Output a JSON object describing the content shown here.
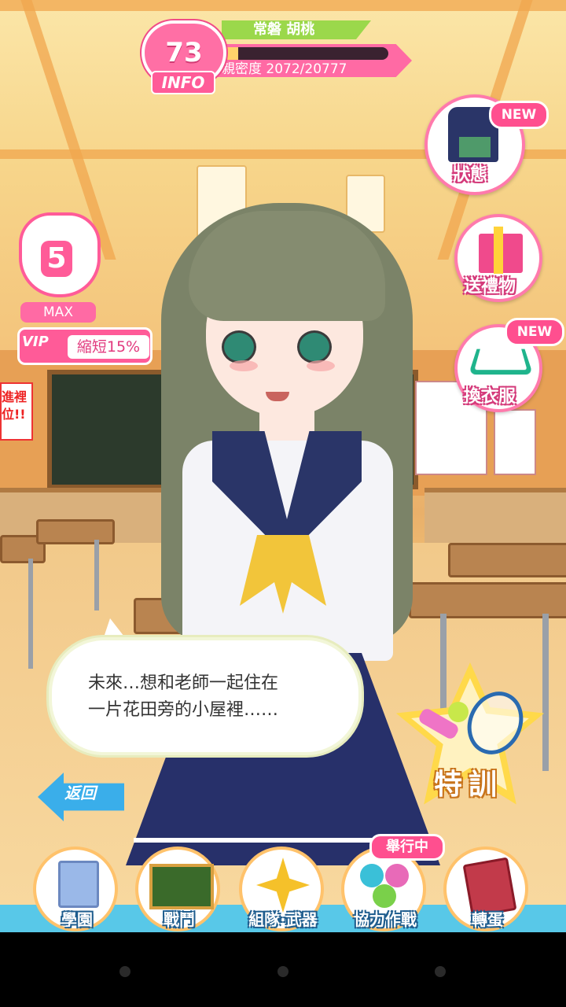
{
  "header": {
    "level": "73",
    "info_label": "INFO",
    "character_name": "常磐 胡桃",
    "affection_label": "親密度 2072/20777",
    "affection_progress": 0.0997
  },
  "stamina": {
    "count": "5",
    "max_label": "MAX",
    "vip_label": "VIP",
    "vip_text": "縮短15%"
  },
  "side_buttons": {
    "status": {
      "label": "狀態",
      "badge": "NEW"
    },
    "gift": {
      "label": "送禮物"
    },
    "wardrobe": {
      "label": "換衣服",
      "badge": "NEW"
    }
  },
  "dialogue": {
    "text": "未來…想和老師一起住在\n一片花田旁的小屋裡……"
  },
  "back_button": {
    "label": "返回"
  },
  "training": {
    "label": "特訓"
  },
  "bottom_nav": {
    "event_badge": "舉行中",
    "items": [
      {
        "label": "學園"
      },
      {
        "label": "戰鬥"
      },
      {
        "label": "組隊·武器"
      },
      {
        "label": "協力作戰"
      },
      {
        "label": "轉蛋"
      }
    ]
  },
  "background_signs": {
    "left_sign": "進裡\n位!!"
  },
  "colors": {
    "accent_pink": "#ff5b98",
    "name_green": "#9bd84b",
    "nav_blue": "#58c8e8"
  }
}
